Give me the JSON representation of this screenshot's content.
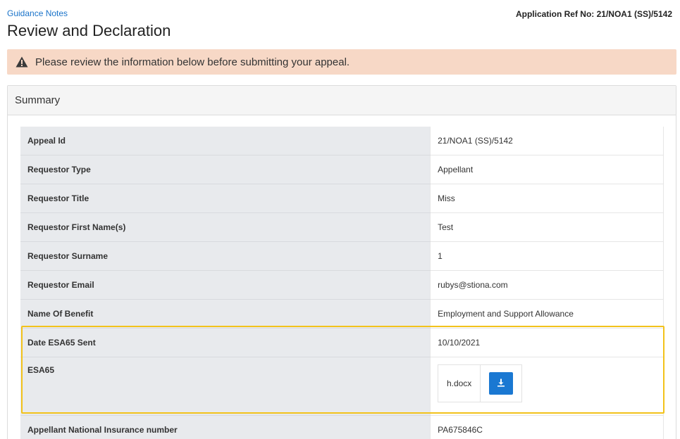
{
  "header": {
    "guidance_link": "Guidance Notes",
    "title": "Review and Declaration",
    "app_ref": "Application Ref No: 21/NOA1 (SS)/5142"
  },
  "alert": {
    "icon": "warning-triangle-icon",
    "text": "Please review the information below before submitting your appeal."
  },
  "summary": {
    "heading": "Summary",
    "rows": [
      {
        "label": "Appeal Id",
        "value": "21/NOA1 (SS)/5142"
      },
      {
        "label": "Requestor Type",
        "value": "Appellant"
      },
      {
        "label": "Requestor Title",
        "value": "Miss"
      },
      {
        "label": "Requestor First Name(s)",
        "value": "Test"
      },
      {
        "label": "Requestor Surname",
        "value": "1"
      },
      {
        "label": "Requestor Email",
        "value": "rubys@stiona.com"
      },
      {
        "label": "Name Of Benefit",
        "value": "Employment and Support Allowance"
      },
      {
        "label": "Date ESA65 Sent",
        "value": "10/10/2021"
      },
      {
        "label": "ESA65",
        "file_name": "h.docx",
        "icon": "download-icon"
      },
      {
        "label": "Appellant National Insurance number",
        "value": "PA675846C"
      }
    ]
  },
  "colors": {
    "link": "#1a73c9",
    "alert_bg": "#f7d8c6",
    "highlight": "#f2c21b",
    "download_button": "#1a78d2"
  }
}
